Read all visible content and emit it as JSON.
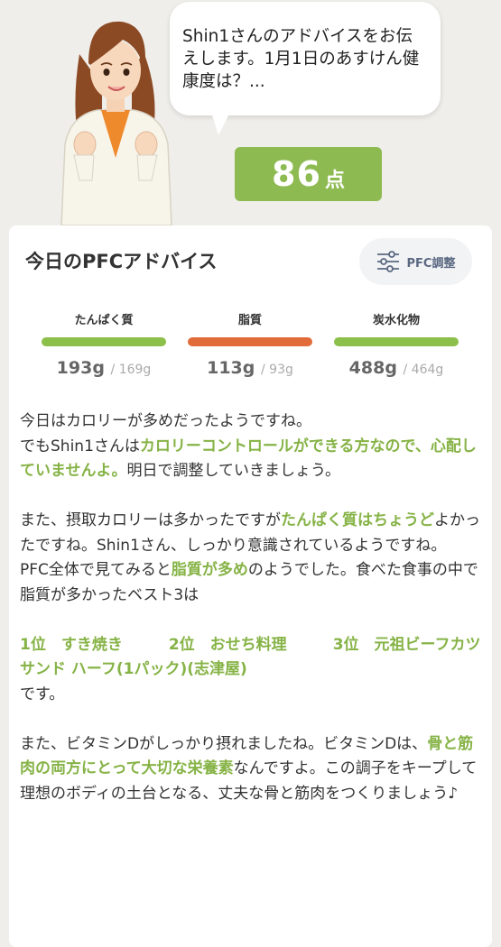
{
  "colors": {
    "background": "#efeeea",
    "accent_green": "#8eba52",
    "highlight_green": "#86b346",
    "fat_orange": "#e16c3a",
    "button_bg": "#f2f3f5"
  },
  "header": {
    "advisor_icon": "advisor-illustration",
    "bubble_text": "Shin1さんのアドバイスをお伝えします。1月1日のあすけん健康度は？...",
    "score_value": "86",
    "score_unit": "点"
  },
  "card": {
    "title": "今日のPFCアドバイス",
    "pfc_button_icon": "sliders-icon",
    "pfc_button_label": "PFC調整"
  },
  "metrics": [
    {
      "label": "たんぱく質",
      "value": "193g",
      "target": "/ 169g",
      "color": "#8dc04a"
    },
    {
      "label": "脂質",
      "value": "113g",
      "target": "/ 93g",
      "color": "#e16c3a"
    },
    {
      "label": "炭水化物",
      "value": "488g",
      "target": "/ 464g",
      "color": "#8dc04a"
    }
  ],
  "advice": {
    "p1_line1": "今日はカロリーが多めだったようですね。",
    "p2_a": "でもShin1さんは",
    "p2_hl": "カロリーコントロールができる方なので、心配していませんよ。",
    "p2_b": "明日で調整していきましょう。",
    "p3_a": "また、摂取カロリーは多かったですが",
    "p3_hl": "たんぱく質はちょうど",
    "p3_b": "よかったですね。Shin1さん、しっかり意識されているようですね。",
    "p4_a": "PFC全体で見てみると",
    "p4_hl": "脂質が多め",
    "p4_b": "のようでした。食べた食事の中で脂質が多かったベスト3は",
    "rank_1": "1位　すき焼き",
    "rank_2": "2位　おせち料理",
    "rank_3": "3位　元祖ビーフカツサンド ハーフ(1パック)(志津屋)",
    "p5": "です。",
    "p6_a": "また、ビタミンDがしっかり摂れましたね。ビタミンDは、",
    "p6_hl": "骨と筋肉の両方にとって大切な栄養素",
    "p6_b": "なんですよ。この調子をキープして理想のボディの土台となる、丈夫な骨と筋肉をつくりましょう♪"
  }
}
